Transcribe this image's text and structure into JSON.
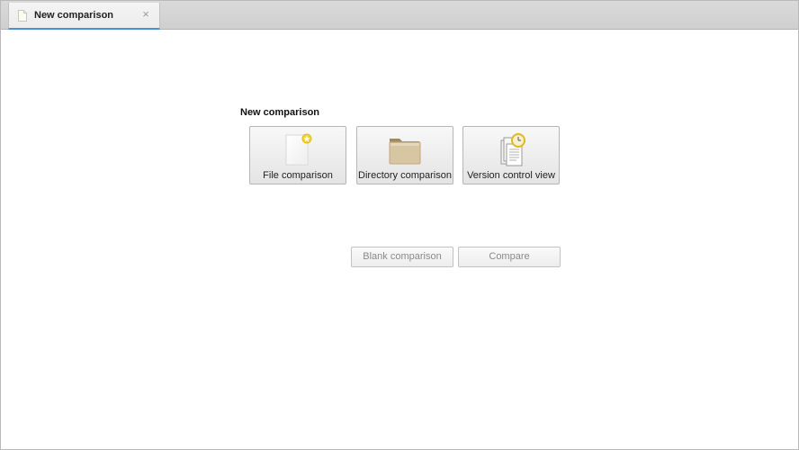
{
  "tab": {
    "title": "New comparison",
    "close_glyph": "×",
    "icon": "document-icon"
  },
  "main": {
    "section_title": "New comparison",
    "options": [
      {
        "label": "File comparison",
        "icon": "new-file-icon"
      },
      {
        "label": "Directory comparison",
        "icon": "folder-icon"
      },
      {
        "label": "Version control view",
        "icon": "version-control-icon"
      }
    ],
    "actions": {
      "blank_label": "Blank comparison",
      "compare_label": "Compare"
    }
  },
  "colors": {
    "tab_accent": "#4a90d9",
    "folder": "#d8c5a2",
    "star": "#f2d23c",
    "clock": "#e0b820"
  }
}
